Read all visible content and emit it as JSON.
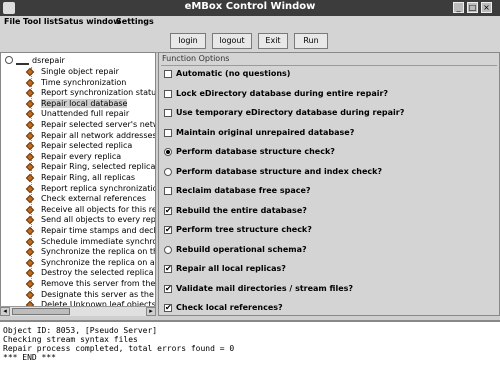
{
  "window": {
    "title": "eMBox Control Window",
    "controls": [
      "_",
      "□",
      "×"
    ]
  },
  "menu": {
    "items": [
      "File",
      "Tool list",
      "Satus window",
      "Settings"
    ]
  },
  "toolbar": {
    "buttons": [
      "login",
      "logout",
      "Exit",
      "Run"
    ]
  },
  "tree": {
    "root": "dsrepair",
    "items": [
      "Single object repair",
      "Time synchronization",
      "Report synchronization status o",
      "Repair local database",
      "Unattended full repair",
      "Repair selected server's netwo",
      "Repair all network addresses",
      "Repair selected replica",
      "Repair every replica",
      "Repair Ring, selected replica",
      "Repair Ring, all replicas",
      "Report replica synchronization s",
      "Check external references",
      "Receive all objects for this repli",
      "Send all objects to every replica",
      "Repair time stamps and declar",
      "Schedule immediate synchront",
      "Synchronize the replica on the s",
      "Synchronize the replica on all se",
      "Destroy the selected replica on",
      "Remove this server from the rep",
      "Designate this server as the ne",
      "Delete Unknown leaf objects"
    ],
    "selected": "Repair local database"
  },
  "function_options": {
    "title": "Function Options",
    "options": [
      {
        "label": "Automatic (no questions)",
        "type": "checkbox",
        "checked": false
      },
      {
        "label": "Lock eDirectory database during entire repair?",
        "type": "checkbox",
        "checked": false
      },
      {
        "label": "Use temporary eDirectory database during repair?",
        "type": "checkbox",
        "checked": false
      },
      {
        "label": "Maintain original unrepaired database?",
        "type": "checkbox",
        "checked": false
      },
      {
        "label": "Perform database structure check?",
        "type": "radio",
        "checked": true
      },
      {
        "label": "Perform database structure and index check?",
        "type": "radio",
        "checked": false
      },
      {
        "label": "Reclaim database free space?",
        "type": "checkbox",
        "checked": false
      },
      {
        "label": "Rebuild the entire database?",
        "type": "checkbox",
        "checked": true
      },
      {
        "label": "Perform tree structure check?",
        "type": "checkbox",
        "checked": true
      },
      {
        "label": "Rebuild operational schema?",
        "type": "radio",
        "checked": false
      },
      {
        "label": "Repair all local replicas?",
        "type": "checkbox",
        "checked": true
      },
      {
        "label": "Validate mail directories / stream files?",
        "type": "checkbox",
        "checked": true
      },
      {
        "label": "Check local references?",
        "type": "checkbox",
        "checked": true
      }
    ]
  },
  "console": {
    "lines": [
      "Object ID: 8053, [Pseudo Server]",
      "Checking stream syntax files",
      "Repair process completed, total errors found = 0",
      "*** END ***"
    ]
  }
}
